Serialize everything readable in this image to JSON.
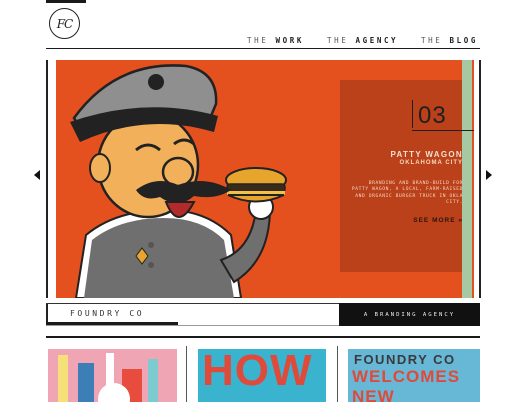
{
  "brand": {
    "logo_monogram": "FC"
  },
  "nav": [
    {
      "prefix": "THE",
      "label": "WORK"
    },
    {
      "prefix": "THE",
      "label": "AGENCY"
    },
    {
      "prefix": "THE",
      "label": "BLOG"
    }
  ],
  "slide": {
    "number": "03",
    "title": "PATTY WAGON",
    "location": "OKLAHOMA CITY",
    "description": "BRANDING AND BRAND-BUILD FOR PATTY WAGON, A LOCAL, FARM-RAISED AND ORGANIC BURGER TRUCK IN OKLA CITY.",
    "more_label": "SEE MORE »"
  },
  "caption": {
    "company": "FOUNDRY CO",
    "tagline": "A BRANDING AGENCY"
  },
  "thumbnails": [
    {
      "name": "thumb-1",
      "text": ""
    },
    {
      "name": "thumb-2",
      "text": "HOW"
    },
    {
      "name": "thumb-3",
      "line1": "FOUNDRY CO",
      "line2": "WELCOMES NEW"
    }
  ],
  "colors": {
    "slide_bg": "#e5501f",
    "accent_stripe": "#a6c9a4",
    "ink": "#1a1a1a"
  },
  "icons": [
    "arrow-left-icon",
    "arrow-right-icon",
    "logo-icon"
  ]
}
